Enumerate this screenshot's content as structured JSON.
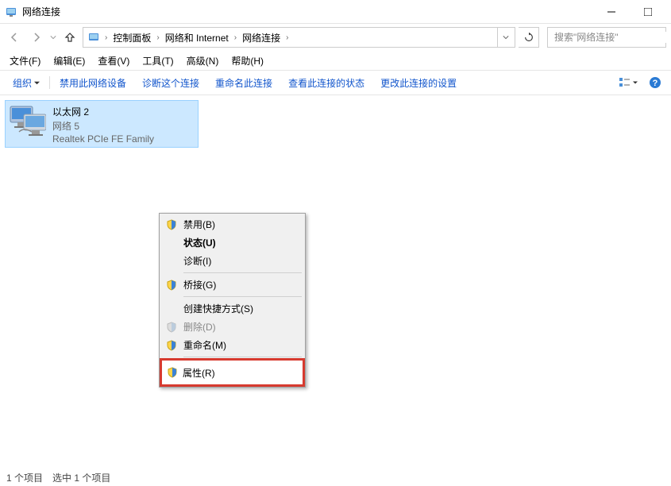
{
  "window": {
    "title": "网络连接",
    "minimize": "—",
    "maximize": "☐"
  },
  "breadcrumbs": {
    "items": [
      "控制面板",
      "网络和 Internet",
      "网络连接"
    ]
  },
  "search": {
    "placeholder": "搜索\"网络连接\""
  },
  "menubar": {
    "items": [
      "文件(F)",
      "编辑(E)",
      "查看(V)",
      "工具(T)",
      "高级(N)",
      "帮助(H)"
    ]
  },
  "toolbar": {
    "organize": "组织",
    "items": [
      "禁用此网络设备",
      "诊断这个连接",
      "重命名此连接",
      "查看此连接的状态",
      "更改此连接的设置"
    ]
  },
  "connection": {
    "name": "以太网 2",
    "network": "网络 5",
    "adapter": "Realtek PCIe FE Family"
  },
  "context_menu": {
    "disable": "禁用(B)",
    "status": "状态(U)",
    "diagnose": "诊断(I)",
    "bridge": "桥接(G)",
    "shortcut": "创建快捷方式(S)",
    "delete": "删除(D)",
    "rename": "重命名(M)",
    "properties": "属性(R)"
  },
  "statusbar": {
    "text": "1 个项目　选中 1 个项目"
  }
}
